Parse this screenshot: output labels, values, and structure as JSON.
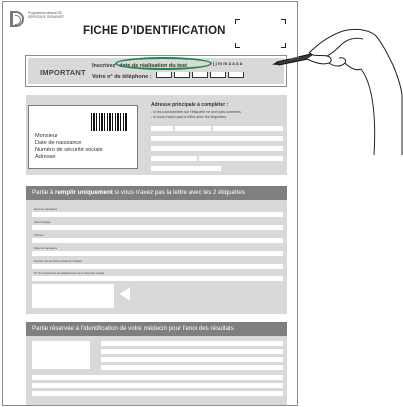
{
  "logo": {
    "text": "Programme national DE DÉPISTAGE ORGANISÉ"
  },
  "title": "FICHE D’IDENTIFICATION",
  "important": {
    "label": "IMPORTANT",
    "line1_prefix": "Inscrivez",
    "line1_text": "date de réalisation du test",
    "date_fields": "j j  m m  a a a a",
    "line2_text": "Votre n° de téléphone :"
  },
  "id_label": {
    "lines": [
      "Monsieur",
      "Date de naissance",
      "Numéro de sécurité sociale",
      "Adresse"
    ]
  },
  "address": {
    "title": "Adresse principale à compléter :",
    "notes": [
      "- si les coordonnées sur l'étiquette ne sont pas correctes",
      "- si vous n'avez pas la lettre avec les étiquettes"
    ]
  },
  "section2": {
    "head_prefix": "Partie à ",
    "head_bold": "remplir uniquement",
    "head_suffix": " si vous n'avez pas la lettre avec les 2 étiquettes",
    "fields": [
      "Nom de naissance",
      "Nom d'usage",
      "Prénom",
      "Date de naissance",
      "Numéro de sécurité sociale de l'assuré",
      "N° de l'organisme de rattachement de la Sécurité sociale"
    ]
  },
  "section3": {
    "head": "Partie réservée à l'identification de votre médecin pour l'enoi des résultats"
  }
}
